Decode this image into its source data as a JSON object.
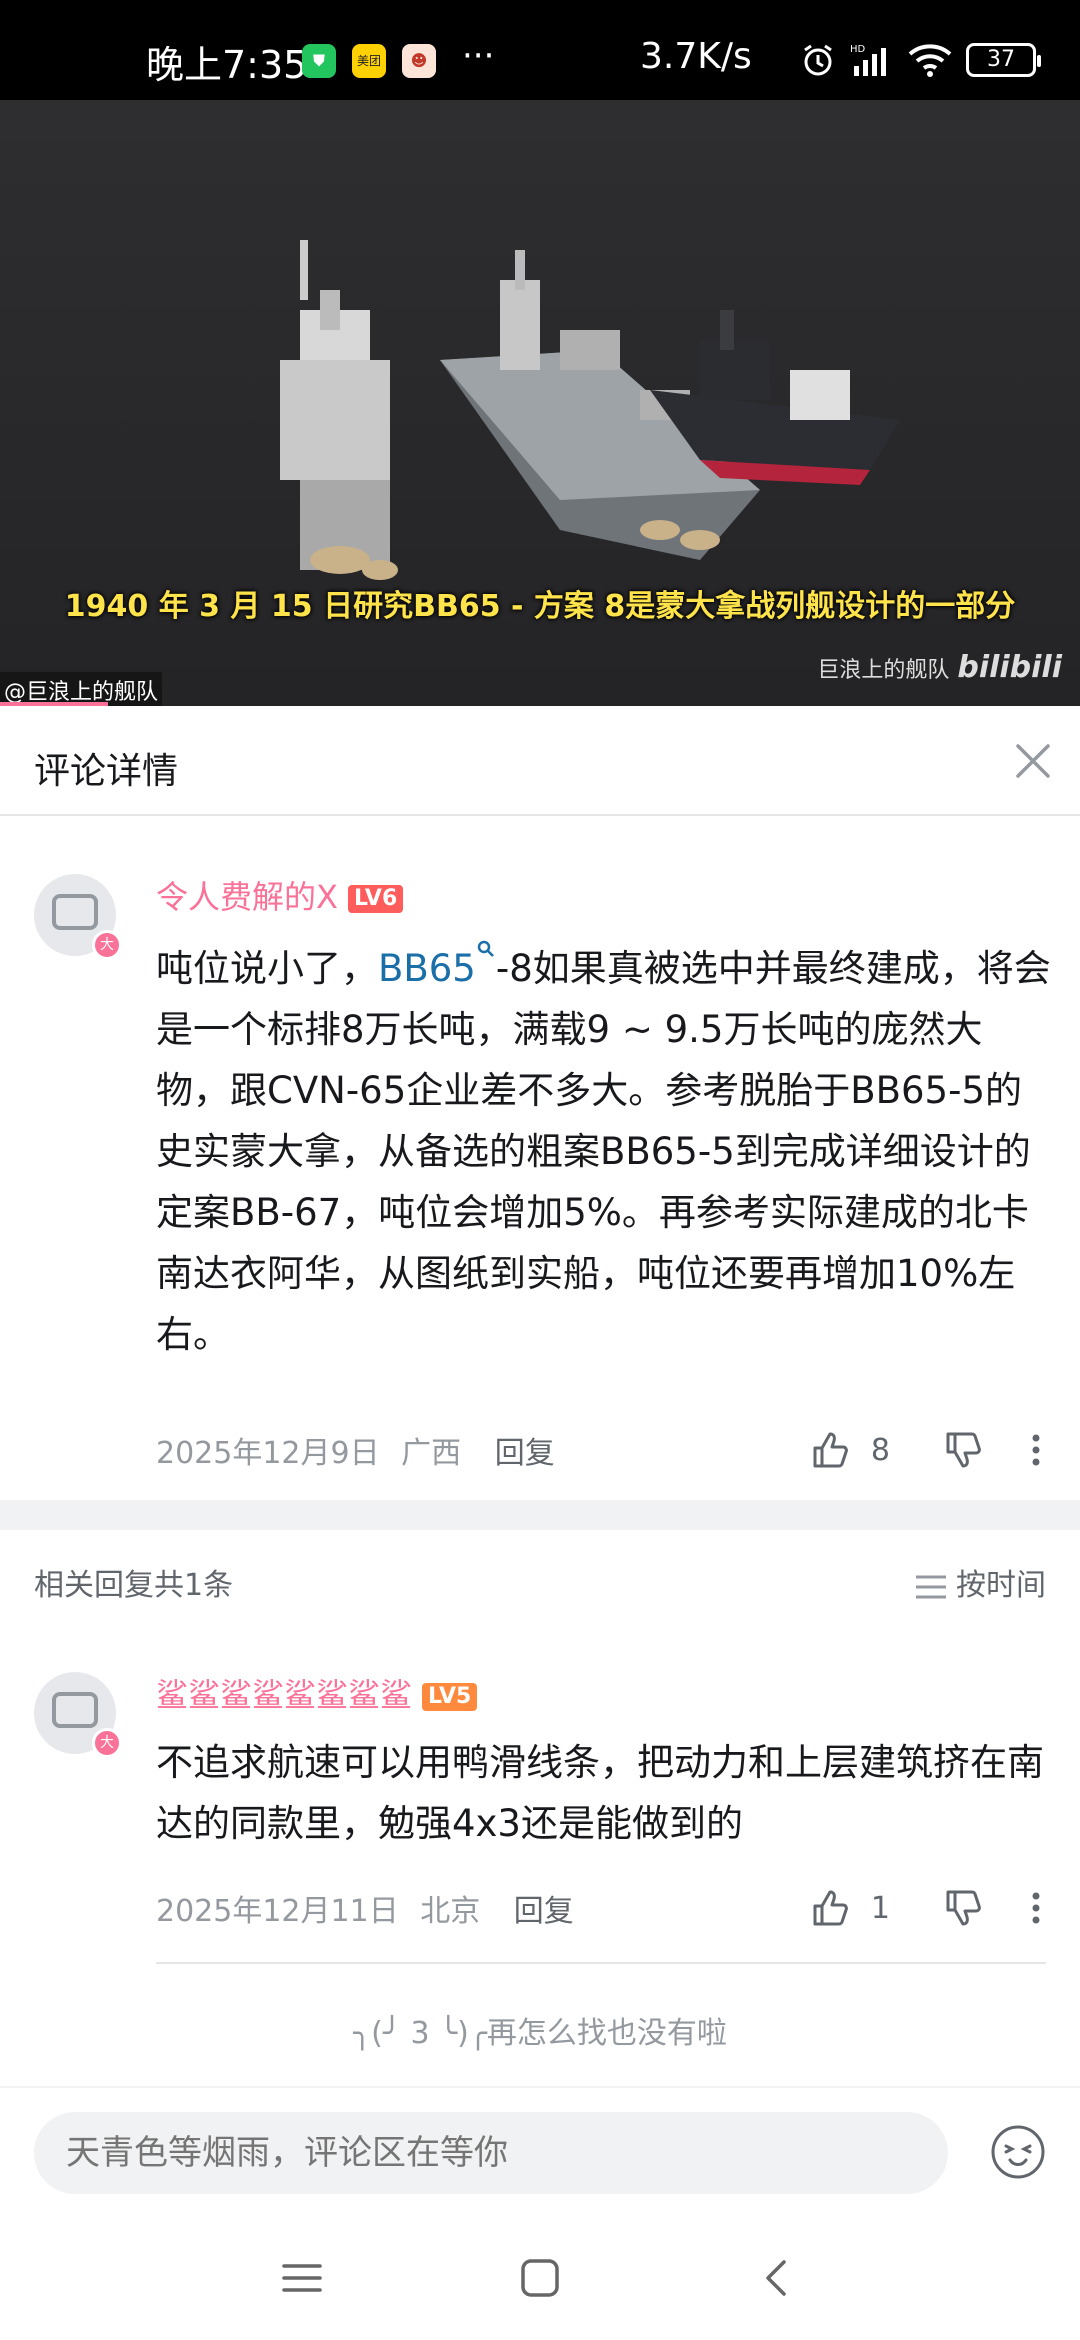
{
  "status_bar": {
    "time": "晚上7:35",
    "more": "···",
    "network_speed": "3.7K/s",
    "battery": "37",
    "icons": [
      "shield-app-icon",
      "meituan-app-icon",
      "game-app-icon",
      "alarm-icon",
      "hd-signal-icon",
      "wifi-icon",
      "battery-icon"
    ]
  },
  "video": {
    "subtitle": "1940 年 3 月 15 日研究BB65 - 方案 8是蒙大拿战列舰设计的一部分",
    "uploader_watermark": "@巨浪上的舰队",
    "brand_watermark": "巨浪上的舰队",
    "brand_logo": "bilibili",
    "progress_fraction": 0.1
  },
  "header": {
    "title": "评论详情"
  },
  "main_comment": {
    "username": "令人费解的X",
    "level": "LV6",
    "text_before_link": "吨位说小了，",
    "link": "BB65",
    "text_after_link": "-8如果真被选中并最终建成，将会是一个标排8万长吨，满载9 ~ 9.5万长吨的庞然大物，跟CVN-65企业差不多大。参考脱胎于BB65-5的史实蒙大拿，从备选的粗案BB65-5到完成详细设计的定案BB-67，吨位会增加5%。再参考实际建成的北卡南达衣阿华，从图纸到实船，吨位还要再增加10%左右。",
    "date": "2025年12月9日",
    "location": "广西",
    "reply_label": "回复",
    "likes": "8"
  },
  "replies_header": {
    "count": "相关回复共1条",
    "sort": "按时间"
  },
  "reply": {
    "username": "鲨鲨鲨鲨鲨鲨鲨鲨",
    "level": "LV5",
    "text": "不追求航速可以用鸭滑线条，把动力和上层建筑挤在南达的同款里，勉强4x3还是能做到的",
    "date": "2025年12月11日",
    "location": "北京",
    "reply_label": "回复",
    "likes": "1"
  },
  "end_text": "╮(╯ 3 ╰)╭再怎么找也没有啦",
  "input": {
    "placeholder": "天青色等烟雨，评论区在等你"
  },
  "colors": {
    "accent_pink": "#fb7299",
    "link_blue": "#1a6fa8",
    "subtitle_yellow": "#ffe34a"
  }
}
